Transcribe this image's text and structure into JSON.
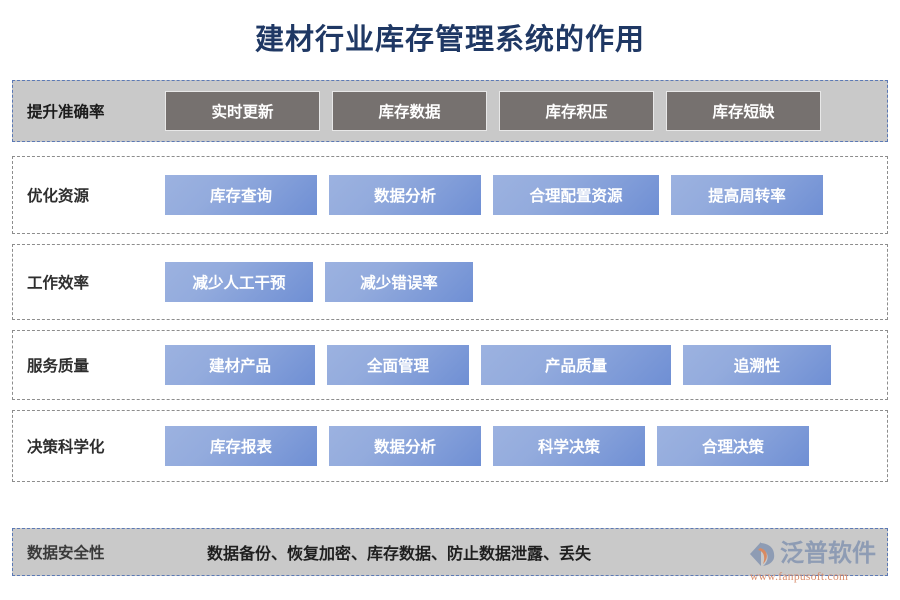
{
  "page": {
    "title": "建材行业库存管理系统的作用"
  },
  "colors": {
    "title_text": "#1f3864",
    "gray_row_bg": "#c9c9c9",
    "gray_tile": "#76716f",
    "blue_tile_light": "#9cb2e0",
    "blue_tile_dark": "#6f8fd4",
    "dashed_border_blue": "#5b79b5",
    "dashed_border_gray": "#8d8d8d",
    "watermark_text": "#8e9cb4",
    "watermark_url": "#d78b6a"
  },
  "rows": [
    {
      "label": "提升准确率",
      "style": "gray",
      "tiles": [
        "实时更新",
        "库存数据",
        "库存积压",
        "库存短缺"
      ]
    },
    {
      "label": "优化资源",
      "style": "plain",
      "tiles": [
        "库存查询",
        "数据分析",
        "合理配置资源",
        "提高周转率"
      ]
    },
    {
      "label": "工作效率",
      "style": "plain",
      "tiles": [
        "减少人工干预",
        "减少错误率"
      ]
    },
    {
      "label": "服务质量",
      "style": "plain",
      "tiles": [
        "建材产品",
        "全面管理",
        "产品质量",
        "追溯性"
      ]
    },
    {
      "label": "决策科学化",
      "style": "plain",
      "tiles": [
        "库存报表",
        "数据分析",
        "科学决策",
        "合理决策"
      ]
    }
  ],
  "bottom": {
    "label": "数据安全性",
    "text": "数据备份、恢复加密、库存数据、防止数据泄露、丢失"
  },
  "watermark": {
    "icon": "fanpu-logo-icon",
    "name": "泛普软件",
    "url": "www.fanpusoft.com"
  }
}
